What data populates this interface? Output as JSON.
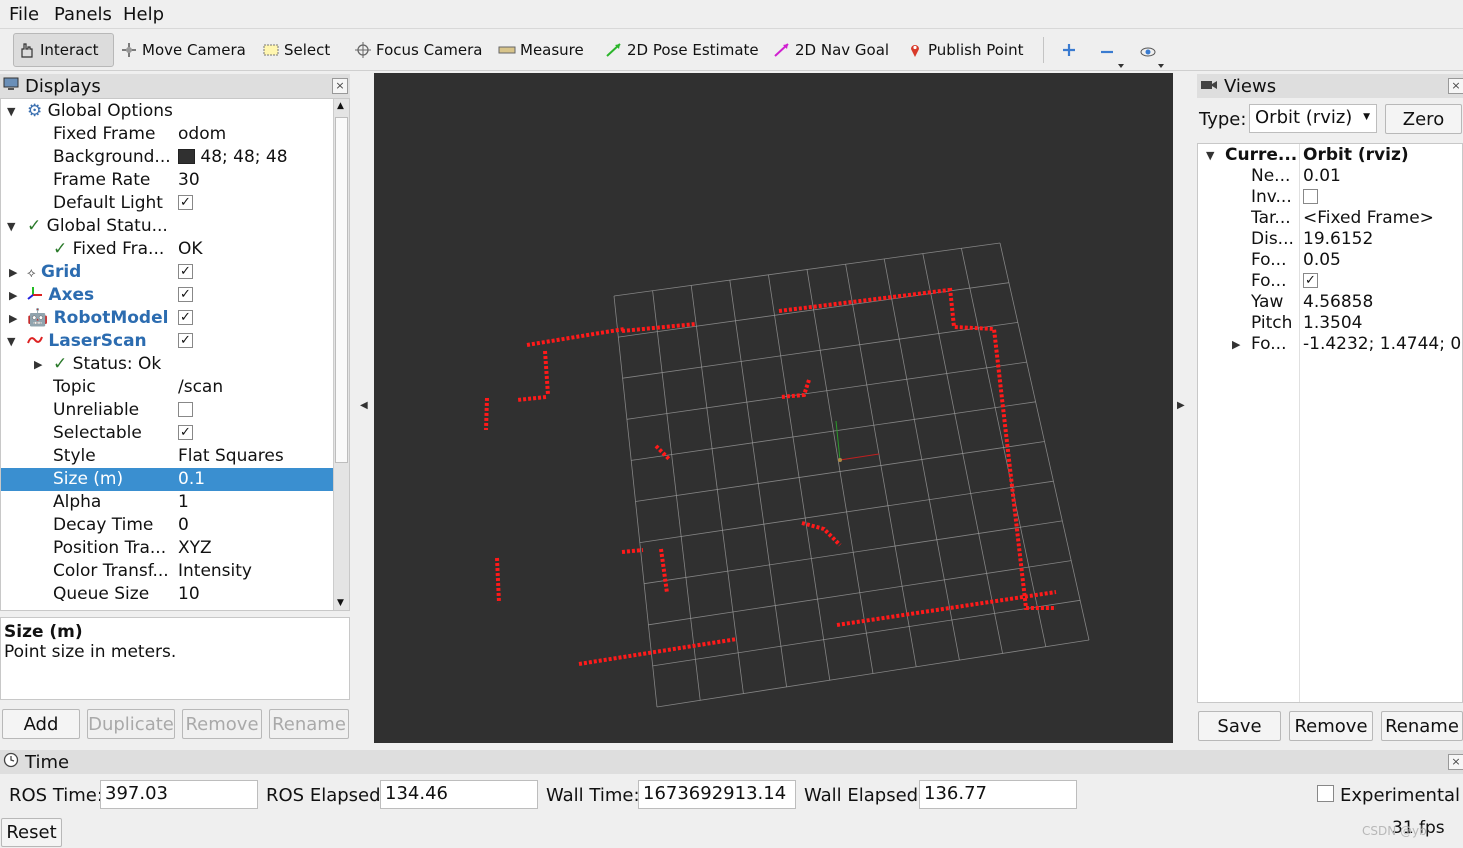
{
  "menu": [
    "File",
    "Panels",
    "Help"
  ],
  "toolbar": {
    "interact": "Interact",
    "move_camera": "Move Camera",
    "select": "Select",
    "focus_camera": "Focus Camera",
    "measure": "Measure",
    "pose_estimate": "2D Pose Estimate",
    "nav_goal": "2D Nav Goal",
    "publish_point": "Publish Point"
  },
  "displays": {
    "title": "Displays",
    "rows": [
      {
        "name": "Global Options",
        "value": ""
      },
      {
        "name": "Fixed Frame",
        "value": "odom"
      },
      {
        "name": "Background...",
        "value": "48; 48; 48"
      },
      {
        "name": "Frame Rate",
        "value": "30"
      },
      {
        "name": "Default Light",
        "value": ""
      },
      {
        "name": "Global Statu...",
        "value": ""
      },
      {
        "name": "Fixed Fra...",
        "value": "OK"
      },
      {
        "name": "Grid",
        "value": ""
      },
      {
        "name": "Axes",
        "value": ""
      },
      {
        "name": "RobotModel",
        "value": ""
      },
      {
        "name": "LaserScan",
        "value": ""
      },
      {
        "name": "Status: Ok",
        "value": ""
      },
      {
        "name": "Topic",
        "value": "/scan"
      },
      {
        "name": "Unreliable",
        "value": ""
      },
      {
        "name": "Selectable",
        "value": ""
      },
      {
        "name": "Style",
        "value": "Flat Squares"
      },
      {
        "name": "Size (m)",
        "value": "0.1"
      },
      {
        "name": "Alpha",
        "value": "1"
      },
      {
        "name": "Decay Time",
        "value": "0"
      },
      {
        "name": "Position Tra...",
        "value": "XYZ"
      },
      {
        "name": "Color Transf...",
        "value": "Intensity"
      },
      {
        "name": "Queue Size",
        "value": "10"
      }
    ],
    "description_title": "Size (m)",
    "description_text": "Point size in meters.",
    "buttons": {
      "add": "Add",
      "duplicate": "Duplicate",
      "remove": "Remove",
      "rename": "Rename"
    }
  },
  "views": {
    "title": "Views",
    "type_label": "Type:",
    "type_value": "Orbit (rviz)",
    "zero": "Zero",
    "header_name": "Curre...",
    "header_value": "Orbit (rviz)",
    "rows": [
      {
        "name": "Ne...",
        "value": "0.01"
      },
      {
        "name": "Inv...",
        "value": ""
      },
      {
        "name": "Tar...",
        "value": "<Fixed Frame>"
      },
      {
        "name": "Dis...",
        "value": "19.6152"
      },
      {
        "name": "Fo...",
        "value": "0.05"
      },
      {
        "name": "Fo...",
        "value": ""
      },
      {
        "name": "Yaw",
        "value": "4.56858"
      },
      {
        "name": "Pitch",
        "value": "1.3504"
      },
      {
        "name": "Fo...",
        "value": "-1.4232; 1.4744; 0..."
      }
    ],
    "buttons": {
      "save": "Save",
      "remove": "Remove",
      "rename": "Rename"
    }
  },
  "time": {
    "title": "Time",
    "ros_time_label": "ROS Time:",
    "ros_time": "397.03",
    "ros_elapsed_label": "ROS Elapsed:",
    "ros_elapsed": "134.46",
    "wall_time_label": "Wall Time:",
    "wall_time": "1673692913.14",
    "wall_elapsed_label": "Wall Elapsed:",
    "wall_elapsed": "136.77",
    "experimental": "Experimental",
    "reset": "Reset",
    "fps": "31 fps",
    "watermark": "CSDN @yb"
  },
  "colors": {
    "background": "#303030",
    "grid": "#a0a0a0",
    "laser": "#ff1a1a",
    "selection": "#3a8fd0"
  }
}
